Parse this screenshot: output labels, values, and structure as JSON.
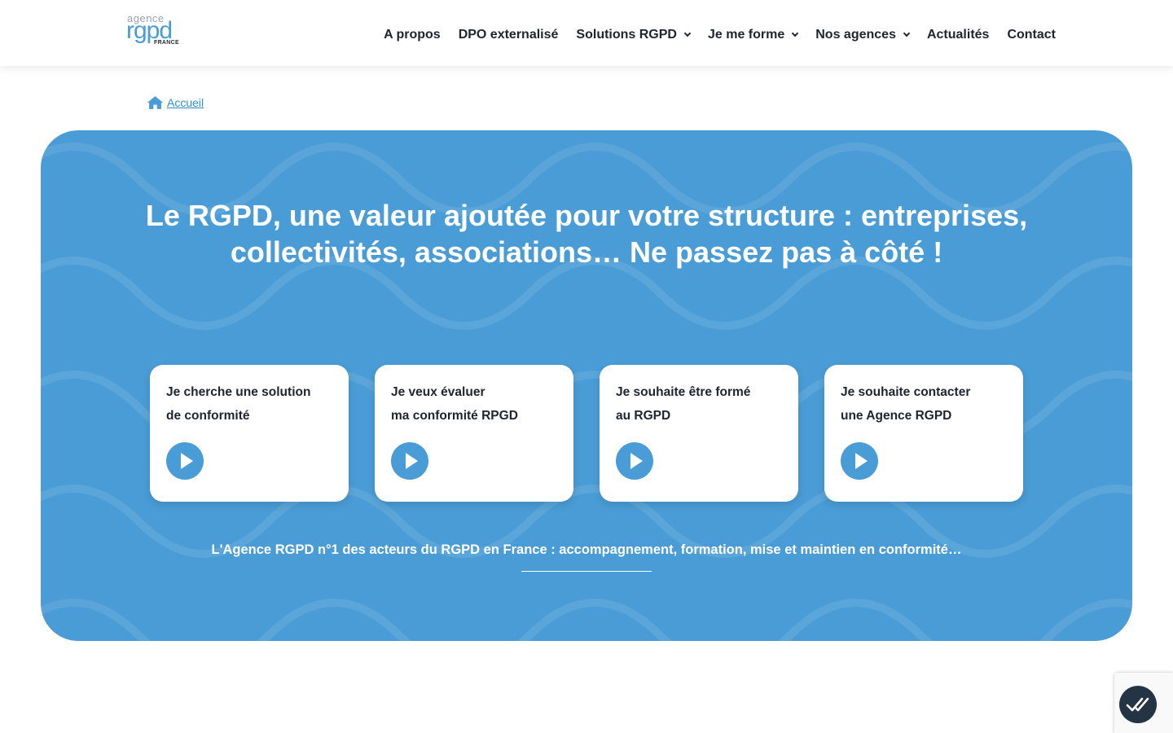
{
  "header": {
    "logo": {
      "top": "agence",
      "main": "rgpd",
      "sub": "FRANCE"
    },
    "nav": [
      {
        "label": "A propos",
        "has_dropdown": false
      },
      {
        "label": "DPO externalisé",
        "has_dropdown": false
      },
      {
        "label": "Solutions RGPD",
        "has_dropdown": true
      },
      {
        "label": "Je me forme",
        "has_dropdown": true
      },
      {
        "label": "Nos agences",
        "has_dropdown": true
      },
      {
        "label": "Actualités",
        "has_dropdown": false
      },
      {
        "label": "Contact",
        "has_dropdown": false
      }
    ]
  },
  "breadcrumb": {
    "icon": "home-icon",
    "label": "Accueil"
  },
  "hero": {
    "title": "Le RGPD, une valeur ajoutée pour votre structure : entreprises, collectivités, associations… Ne passez pas à côté !",
    "cards": [
      {
        "line1": "Je cherche une solution",
        "line2": "de conformité",
        "icon": "play-icon"
      },
      {
        "line1": "Je veux évaluer",
        "line2": "ma conformité RPGD",
        "icon": "play-icon"
      },
      {
        "line1": "Je souhaite être formé",
        "line2": "au RGPD",
        "icon": "play-icon"
      },
      {
        "line1": "Je souhaite contacter",
        "line2": "une Agence RGPD",
        "icon": "play-icon"
      }
    ],
    "tagline": "L'Agence RGPD n°1 des acteurs du RGPD en France : accompagnement, formation, mise et maintien en conformité…"
  },
  "colors": {
    "brand_blue": "#4a9cd6",
    "text_dark": "#1e2430",
    "consent_button": "#253444"
  },
  "consent_button": {
    "icon": "double-check-icon"
  }
}
